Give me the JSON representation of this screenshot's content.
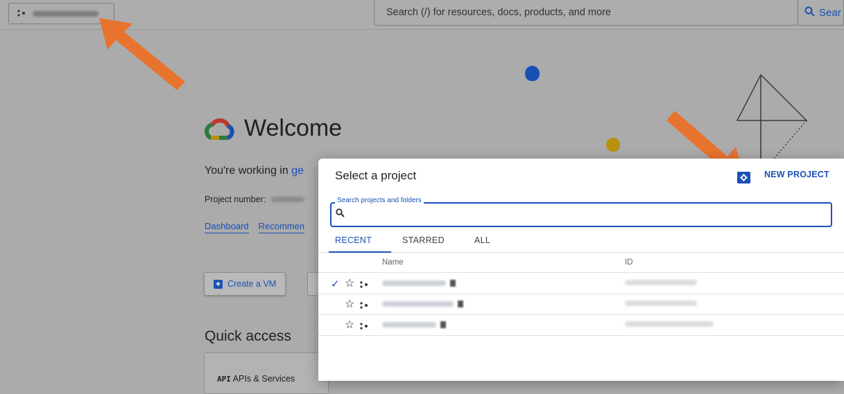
{
  "topbar": {
    "search_placeholder": "Search (/) for resources, docs, products, and more",
    "search_button": "Sear"
  },
  "welcome": {
    "title": "Welcome",
    "working_prefix": "You're working in",
    "working_project": "ge",
    "project_number_label": "Project number:",
    "links": [
      "Dashboard",
      "Recommen"
    ],
    "create_vm_label": "Create a VM",
    "quick_access_title": "Quick access",
    "quick_item_label": "APIs & Services",
    "quick_item_icon": "API"
  },
  "dialog": {
    "title": "Select a project",
    "new_project_label": "NEW PROJECT",
    "search_label": "Search projects and folders",
    "tabs": [
      "RECENT",
      "STARRED",
      "ALL"
    ],
    "active_tab": "RECENT",
    "columns": {
      "name": "Name",
      "id": "ID"
    },
    "rows": [
      {
        "selected": true
      },
      {
        "selected": false
      },
      {
        "selected": false
      }
    ]
  },
  "colors": {
    "accent": "#1a50b5",
    "arrow": "#e8732f",
    "overlay_background": "#ababab"
  }
}
